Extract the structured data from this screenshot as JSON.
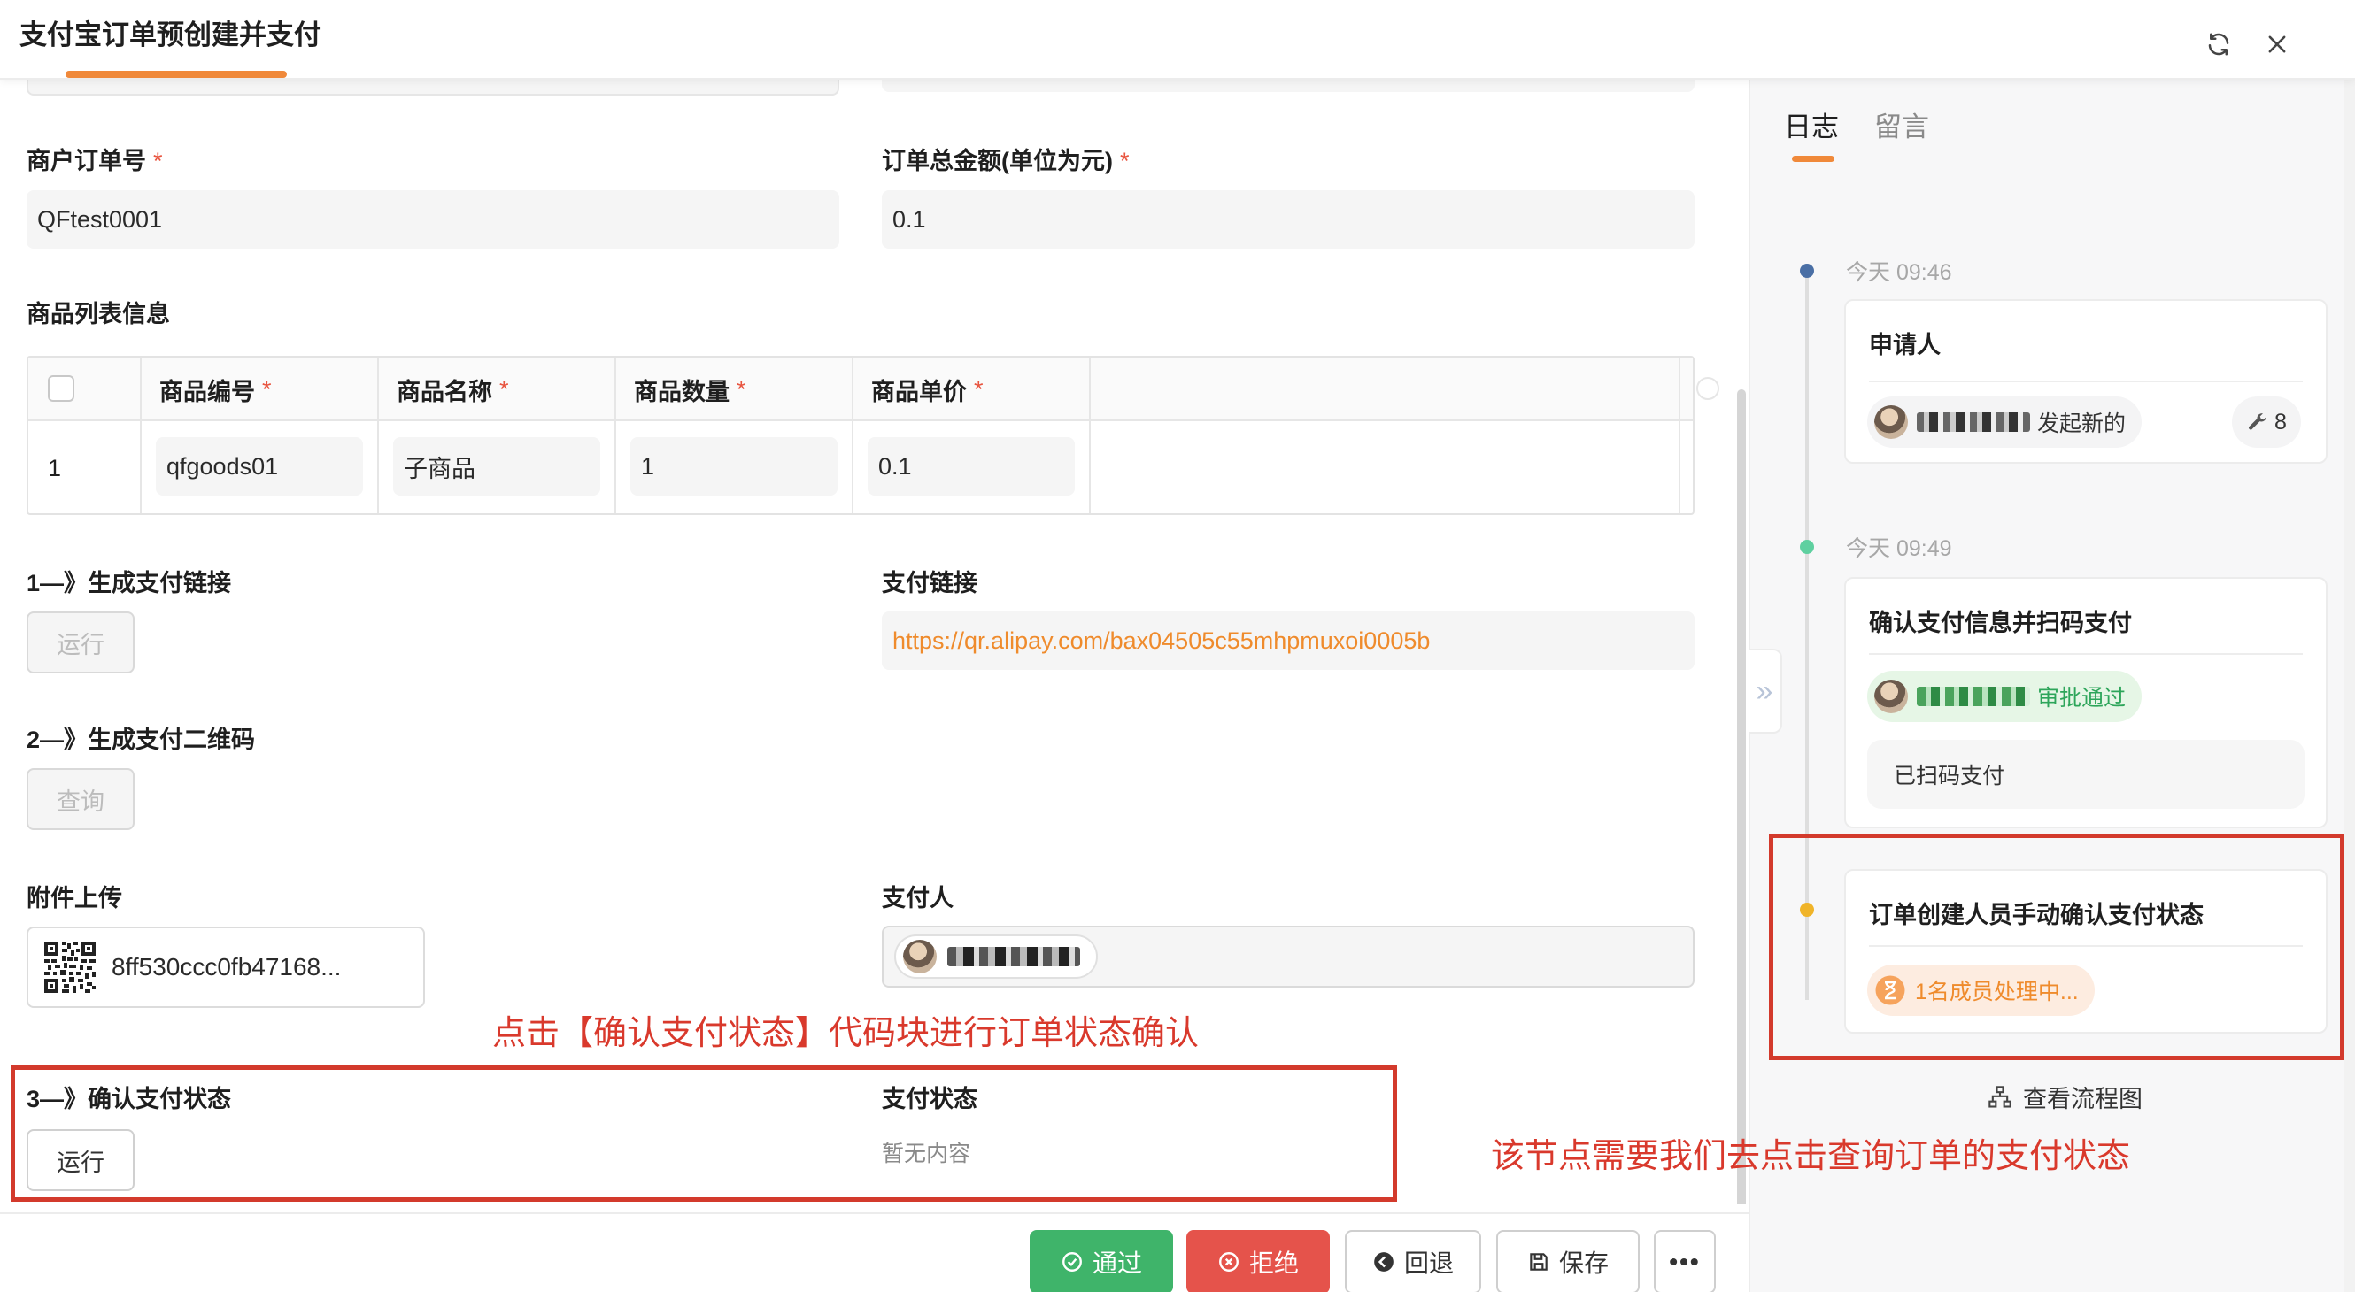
{
  "window": {
    "title": "支付宝订单预创建并支付",
    "refresh_icon": "refresh-icon",
    "close_icon": "close-icon"
  },
  "form": {
    "order_no": {
      "label": "商户订单号",
      "required": "*",
      "value": "QFtest0001"
    },
    "order_amount": {
      "label": "订单总金额(单位为元)",
      "required": "*",
      "value": "0.1"
    },
    "goods_section": {
      "label": "商品列表信息"
    },
    "table": {
      "headers": [
        {
          "label": "商品编号",
          "required": "*"
        },
        {
          "label": "商品名称",
          "required": "*"
        },
        {
          "label": "商品数量",
          "required": "*"
        },
        {
          "label": "商品单价",
          "required": "*"
        }
      ],
      "rows": [
        {
          "index": "1",
          "code": "qfgoods01",
          "name": "子商品",
          "qty": "1",
          "price": "0.1"
        }
      ]
    },
    "step1": {
      "label": "1—》生成支付链接",
      "button": "运行"
    },
    "pay_link": {
      "label": "支付链接",
      "value": "https://qr.alipay.com/bax04505c55mhpmuxoi0005b"
    },
    "step2": {
      "label": "2—》生成支付二维码",
      "button": "查询"
    },
    "attachment": {
      "label": "附件上传",
      "file_name": "8ff530ccc0fb47168..."
    },
    "payer": {
      "label": "支付人"
    },
    "step3": {
      "label": "3—》确认支付状态",
      "button": "运行"
    },
    "pay_status": {
      "label": "支付状态",
      "placeholder": "暂无内容"
    }
  },
  "annotations": {
    "left": "点击【确认支付状态】代码块进行订单状态确认",
    "right": "该节点需要我们去点击查询订单的支付状态"
  },
  "footer": {
    "pass": "通过",
    "reject": "拒绝",
    "back": "回退",
    "save": "保存",
    "more": "•••"
  },
  "side_panel": {
    "tabs": [
      {
        "label": "日志",
        "active": true
      },
      {
        "label": "留言",
        "active": false
      }
    ],
    "timeline": [
      {
        "time": "今天 09:46",
        "dot_color": "#4a6fa5",
        "title": "申请人",
        "action": "发起新的",
        "badge": "8"
      },
      {
        "time": "今天 09:49",
        "dot_color": "#5fd0a0",
        "title": "确认支付信息并扫码支付",
        "action": "审批通过",
        "comment": "已扫码支付"
      },
      {
        "dot_color": "#f0b429",
        "title": "订单创建人员手动确认支付状态",
        "status": "1名成员处理中..."
      }
    ],
    "view_flow": "查看流程图"
  },
  "colors": {
    "accent": "#f0893a",
    "required": "#e8543f",
    "link": "#ef8b2c",
    "pass": "#3fb46a",
    "reject": "#e5534b",
    "annotation": "#d33a2c",
    "approved_text": "#2da55a",
    "pending_text": "#ef8b2c"
  }
}
